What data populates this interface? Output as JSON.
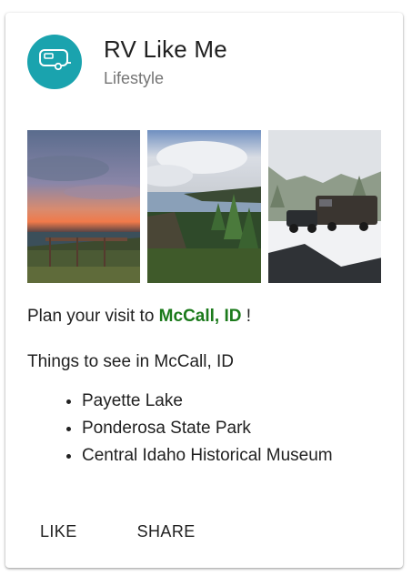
{
  "card": {
    "title": "RV Like Me",
    "subtitle": "Lifestyle",
    "avatar_icon": "rv-trailer-icon",
    "accent_color": "#1aa3ae"
  },
  "content": {
    "visit_prefix": "Plan your visit to ",
    "place": "McCall, ID",
    "visit_suffix": " !",
    "things_heading": "Things to see in McCall, ID",
    "places": [
      "Payette Lake",
      "Ponderosa State Park",
      "Central Idaho Historical Museum"
    ],
    "place_color": "#1b7a1b"
  },
  "actions": {
    "like": "LIKE",
    "share": "SHARE"
  }
}
